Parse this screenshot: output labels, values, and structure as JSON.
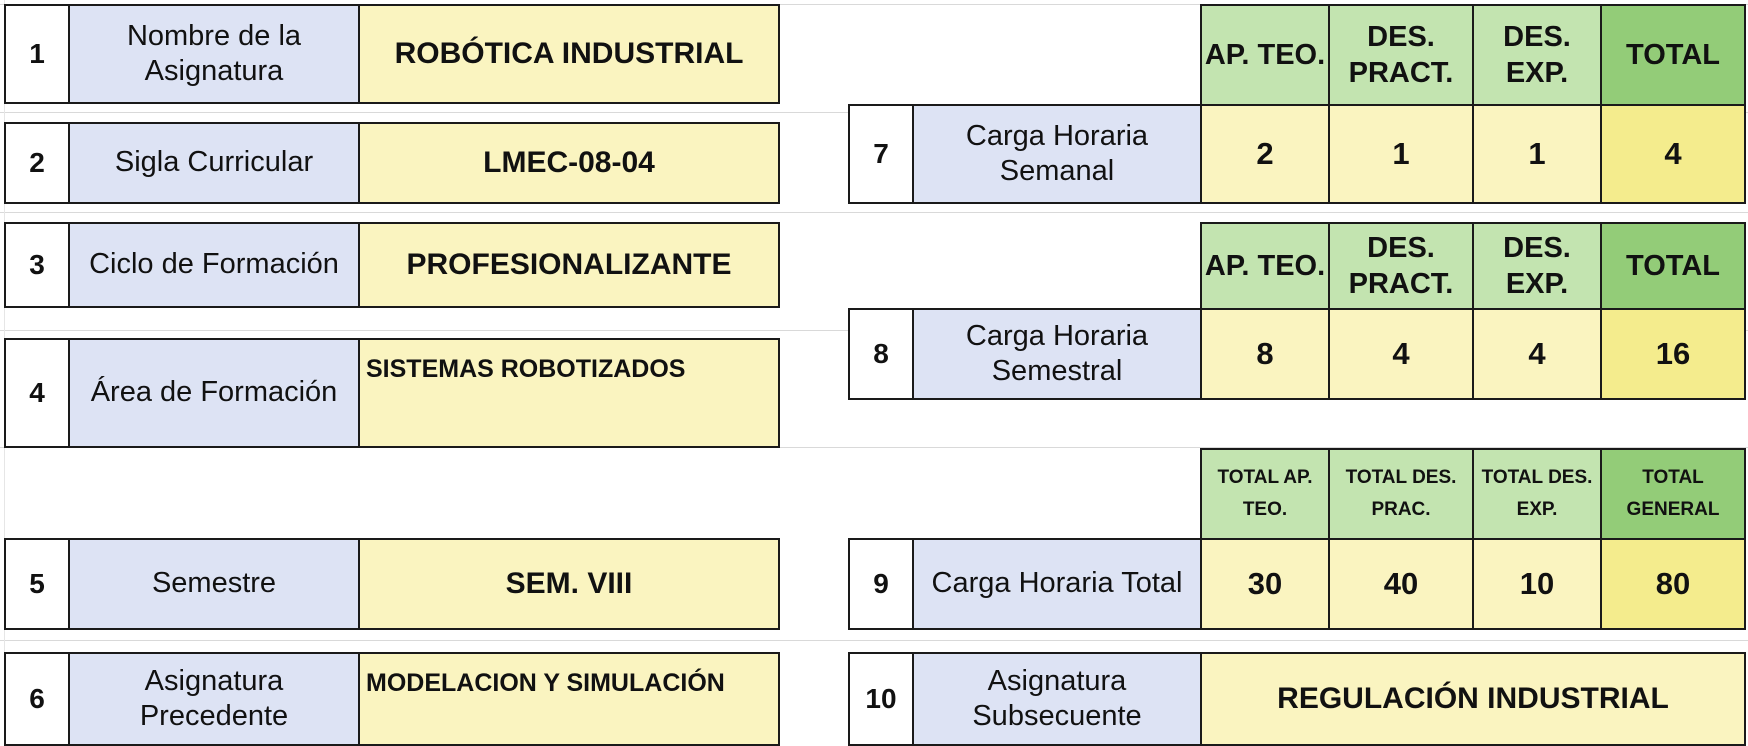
{
  "left": [
    {
      "num": "1",
      "label": "Nombre de la Asignatura",
      "value": "ROBÓTICA INDUSTRIAL"
    },
    {
      "num": "2",
      "label": "Sigla Curricular",
      "value": "LMEC-08-04"
    },
    {
      "num": "3",
      "label": "Ciclo de Formación",
      "value": "PROFESIONALIZANTE"
    },
    {
      "num": "4",
      "label": "Área de Formación",
      "value": "SISTEMAS ROBOTIZADOS"
    },
    {
      "num": "5",
      "label": "Semestre",
      "value": "SEM. VIII"
    },
    {
      "num": "6",
      "label": "Asignatura Precedente",
      "value": "MODELACION Y SIMULACIÓN"
    }
  ],
  "weekly": {
    "num": "7",
    "label": "Carga Horaria Semanal",
    "headers": [
      "AP. TEO.",
      "DES. PRACT.",
      "DES. EXP.",
      "TOTAL"
    ],
    "values": [
      "2",
      "1",
      "1",
      "4"
    ]
  },
  "semester": {
    "num": "8",
    "label": "Carga Horaria Semestral",
    "headers": [
      "AP. TEO.",
      "DES. PRACT.",
      "DES. EXP.",
      "TOTAL"
    ],
    "values": [
      "8",
      "4",
      "4",
      "16"
    ]
  },
  "total": {
    "num": "9",
    "label": "Carga Horaria Total",
    "headers": [
      "TOTAL AP. TEO.",
      "TOTAL DES. PRAC.",
      "TOTAL DES. EXP.",
      "TOTAL GENERAL"
    ],
    "values": [
      "30",
      "40",
      "10",
      "80"
    ]
  },
  "subsequent": {
    "num": "10",
    "label": "Asignatura Subsecuente",
    "value": "REGULACIÓN INDUSTRIAL"
  }
}
